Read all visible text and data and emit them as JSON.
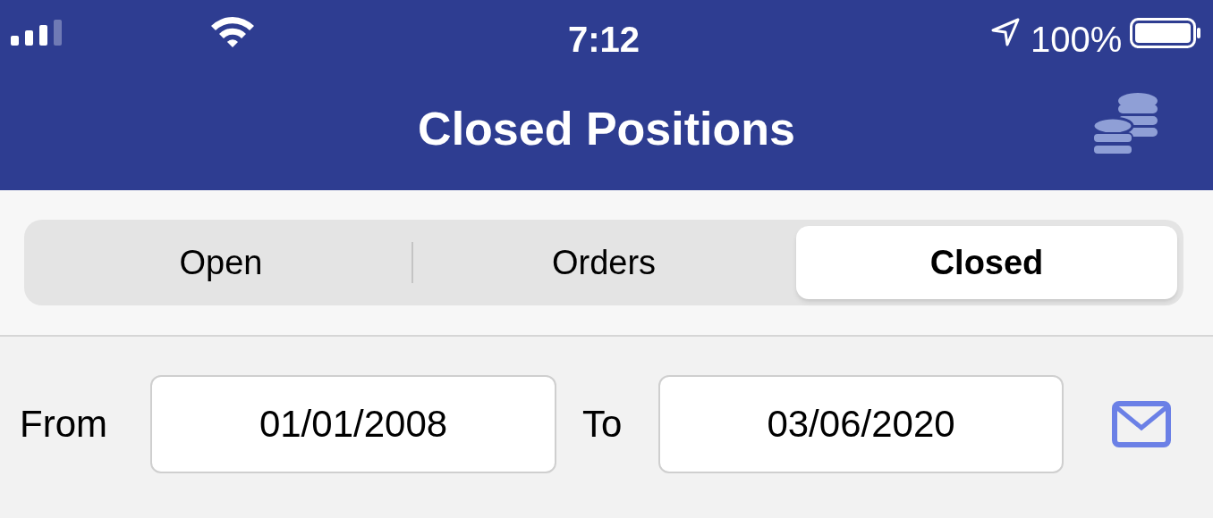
{
  "status_bar": {
    "time": "7:12",
    "battery": "100%"
  },
  "header": {
    "title": "Closed Positions"
  },
  "tabs": [
    {
      "label": "Open",
      "selected": false
    },
    {
      "label": "Orders",
      "selected": false
    },
    {
      "label": "Closed",
      "selected": true
    }
  ],
  "date_filter": {
    "from_label": "From",
    "from_value": "01/01/2008",
    "to_label": "To",
    "to_value": "03/06/2020"
  }
}
